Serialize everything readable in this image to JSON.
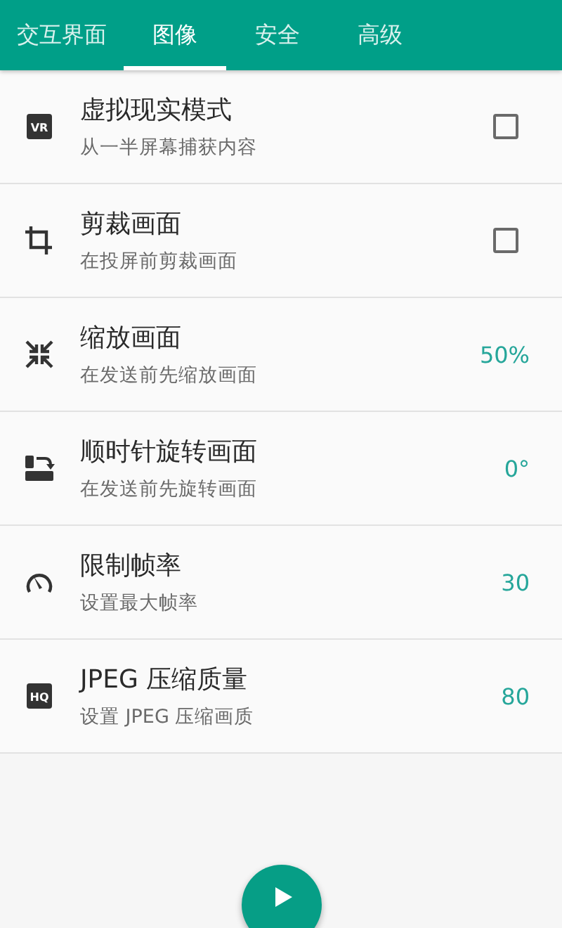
{
  "tabs": [
    {
      "label": "交互界面",
      "selected": false
    },
    {
      "label": "图像",
      "selected": true
    },
    {
      "label": "安全",
      "selected": false
    },
    {
      "label": "高级",
      "selected": false
    }
  ],
  "settings": [
    {
      "kind": "checkbox",
      "icon_text": "VR",
      "title": "虚拟现实模式",
      "subtitle": "从一半屏幕捕获内容",
      "checked": false
    },
    {
      "kind": "checkbox",
      "title": "剪裁画面",
      "subtitle": "在投屏前剪裁画面",
      "checked": false
    },
    {
      "kind": "value",
      "title": "缩放画面",
      "subtitle": "在发送前先缩放画面",
      "value": "50%"
    },
    {
      "kind": "value",
      "title": "顺时针旋转画面",
      "subtitle": "在发送前先旋转画面",
      "value": "0°"
    },
    {
      "kind": "value",
      "title": "限制帧率",
      "subtitle": "设置最大帧率",
      "value": "30"
    },
    {
      "kind": "value",
      "icon_text": "HQ",
      "title": "JPEG 压缩质量",
      "subtitle": "设置 JPEG 压缩画质",
      "value": "80"
    }
  ]
}
